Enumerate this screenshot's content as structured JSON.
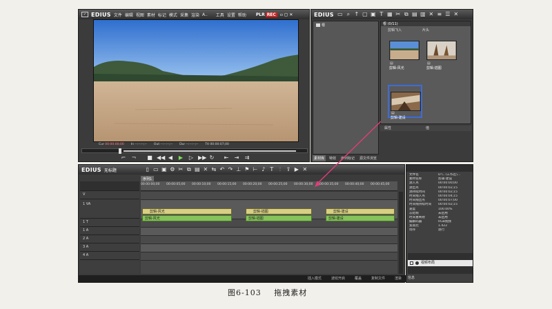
{
  "app": {
    "name": "EDIUS",
    "menu": [
      "文件",
      "编辑",
      "视图",
      "素材",
      "标记",
      "模式",
      "采集",
      "渲染",
      "A..",
      "工具",
      "设置",
      "帮助"
    ],
    "plr_label": "PLR",
    "rec_label": "REC"
  },
  "player": {
    "timecodes": [
      {
        "label": "Cur",
        "value": "00:00:00;00"
      },
      {
        "label": "In",
        "value": "--:--:--;--"
      },
      {
        "label": "Out",
        "value": "--:--:--;--"
      },
      {
        "label": "Dur",
        "value": "--:--:--;--"
      },
      {
        "label": "Ttl",
        "value": "00:00:07;00"
      }
    ],
    "controls": [
      "mark-in",
      "mark-out",
      "stop",
      "rewind",
      "step-back",
      "play",
      "step-forward",
      "fast-forward",
      "loop",
      "insert",
      "overwrite"
    ]
  },
  "bin": {
    "logo": "EDIUS",
    "folder_tab": "根",
    "view_title": "根 (0/11)",
    "col_headers": [
      "剪辑飞入",
      "片头"
    ],
    "clips": [
      {
        "label": "剪辑-风光"
      },
      {
        "label": "剪辑-插图"
      },
      {
        "label": "剪辑-建设"
      }
    ],
    "property_header": [
      "属性",
      "值"
    ],
    "bottom_tabs": [
      "素材库",
      "特效",
      "序列标记",
      "源文件浏览"
    ]
  },
  "timeline": {
    "logo": "EDIUS",
    "project": "无标题",
    "sequence_tab": "序列1",
    "ruler": [
      "00:00:00;00",
      "00:00:05;00",
      "00:00:10;00",
      "00:00:15;00",
      "00:00:20;00",
      "00:00:25;00",
      "00:00:30;00",
      "00:00:35;00",
      "00:00:40;00",
      "00:00:45;00"
    ],
    "tracks": [
      {
        "name": "V",
        "sub": "1 VA"
      },
      {
        "name": "1 T"
      },
      {
        "name": "1 A"
      },
      {
        "name": "2 A"
      },
      {
        "name": "3 A"
      },
      {
        "name": "4 A"
      }
    ],
    "clips": [
      {
        "top": "剪辑-风光",
        "bottom": "剪辑-风光"
      },
      {
        "top": "剪辑-插图",
        "bottom": "剪辑-插图"
      },
      {
        "top": "剪辑-建设",
        "bottom": "剪辑-建设"
      }
    ],
    "status_items": [
      "插入模式",
      "波纹开启",
      "覆盖",
      "复制文件",
      "渲染"
    ]
  },
  "info": {
    "rows": [
      {
        "k": "文件名",
        "v": "D:\\...\\工作区\\..."
      },
      {
        "k": "素材名称",
        "v": "剪辑-建设"
      },
      {
        "k": "源入点",
        "v": "00:00:00;00"
      },
      {
        "k": "源出点",
        "v": "00:00:02;15"
      },
      {
        "k": "源持续时间",
        "v": "00:00:02;15"
      },
      {
        "k": "时间线入点",
        "v": "00:00:04;15"
      },
      {
        "k": "时间线出点",
        "v": "00:00:07;00"
      },
      {
        "k": "时间线持续时间",
        "v": "00:00:02;15"
      },
      {
        "k": "速度",
        "v": "100.00%"
      },
      {
        "k": "冻结帧",
        "v": "未启用"
      },
      {
        "k": "时间重映射",
        "v": "未启用"
      },
      {
        "k": "编解码器",
        "v": "RGB视频"
      },
      {
        "k": "宽高比",
        "v": "1.422"
      },
      {
        "k": "场序",
        "v": "逐行"
      }
    ],
    "layer_label": "视频布局",
    "footer": "信息"
  },
  "caption": {
    "figure": "图6-103",
    "title": "拖拽素材"
  }
}
